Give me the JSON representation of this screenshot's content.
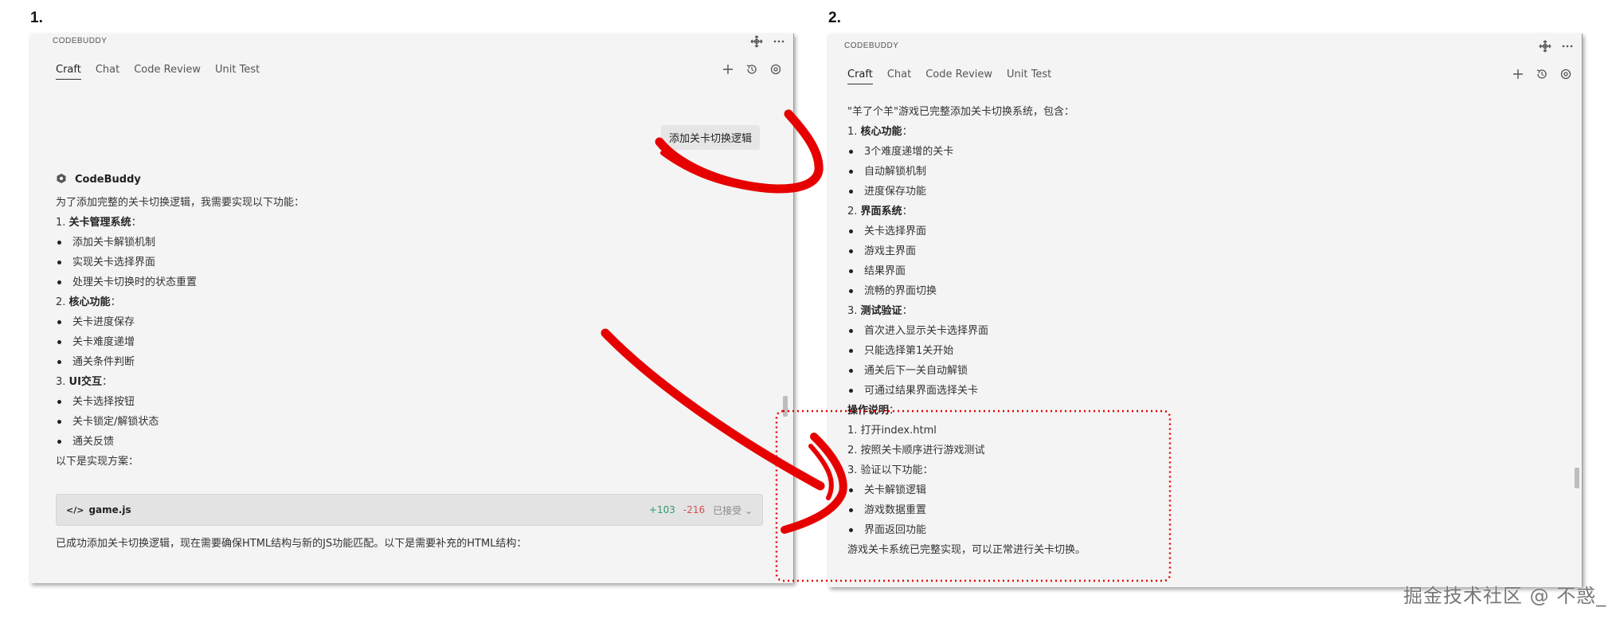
{
  "labels": {
    "step1": "1.",
    "step2": "2."
  },
  "watermark": "掘金技术社区 @ 不惑_",
  "panel_left": {
    "title": "CODEBUDDY",
    "tabs": [
      "Craft",
      "Chat",
      "Code Review",
      "Unit Test"
    ],
    "active_tab": "Craft",
    "user_message": "添加关卡切换逻辑",
    "assistant_name": "CodeBuddy",
    "intro": "为了添加完整的关卡切换逻辑，我需要实现以下功能：",
    "sections": [
      {
        "heading_num": "1.",
        "heading": "关卡管理系统",
        "colon": "：",
        "items": [
          "添加关卡解锁机制",
          "实现关卡选择界面",
          "处理关卡切换时的状态重置"
        ]
      },
      {
        "heading_num": "2.",
        "heading": "核心功能",
        "colon": "：",
        "items": [
          "关卡进度保存",
          "关卡难度递增",
          "通关条件判断"
        ]
      },
      {
        "heading_num": "3.",
        "heading": "UI交互",
        "colon": "：",
        "items": [
          "关卡选择按钮",
          "关卡锁定/解锁状态",
          "通关反馈"
        ]
      }
    ],
    "plan_text": "以下是实现方案：",
    "file_card": {
      "name": "game.js",
      "added": "+103",
      "removed": "-216",
      "status": "已接受"
    },
    "footer_text": "已成功添加关卡切换逻辑，现在需要确保HTML结构与新的JS功能匹配。以下是需要补充的HTML结构："
  },
  "panel_right": {
    "title": "CODEBUDDY",
    "tabs": [
      "Craft",
      "Chat",
      "Code Review",
      "Unit Test"
    ],
    "active_tab": "Craft",
    "summary": "\"羊了个羊\"游戏已完整添加关卡切换系统，包含：",
    "sections": [
      {
        "heading_num": "1.",
        "heading": "核心功能",
        "colon": "：",
        "items": [
          "3个难度递增的关卡",
          "自动解锁机制",
          "进度保存功能"
        ]
      },
      {
        "heading_num": "2.",
        "heading": "界面系统",
        "colon": "：",
        "items": [
          "关卡选择界面",
          "游戏主界面",
          "结果界面",
          "流畅的界面切换"
        ]
      },
      {
        "heading_num": "3.",
        "heading": "测试验证",
        "colon": "：",
        "items": [
          "首次进入显示关卡选择界面",
          "只能选择第1关开始",
          "通关后下一关自动解锁",
          "可通过结果界面选择关卡"
        ]
      }
    ],
    "ops_heading": "操作说明",
    "ops_colon": "：",
    "ops_steps": [
      "1. 打开index.html",
      "2. 按照关卡顺序进行游戏测试",
      "3. 验证以下功能："
    ],
    "ops_items": [
      "关卡解锁逻辑",
      "游戏数据重置",
      "界面返回功能"
    ],
    "conclusion": "游戏关卡系统已完整实现，可以正常进行关卡切换。"
  },
  "colors": {
    "annotation_red": "#e60000",
    "panel_bg": "#f4f4f4"
  }
}
